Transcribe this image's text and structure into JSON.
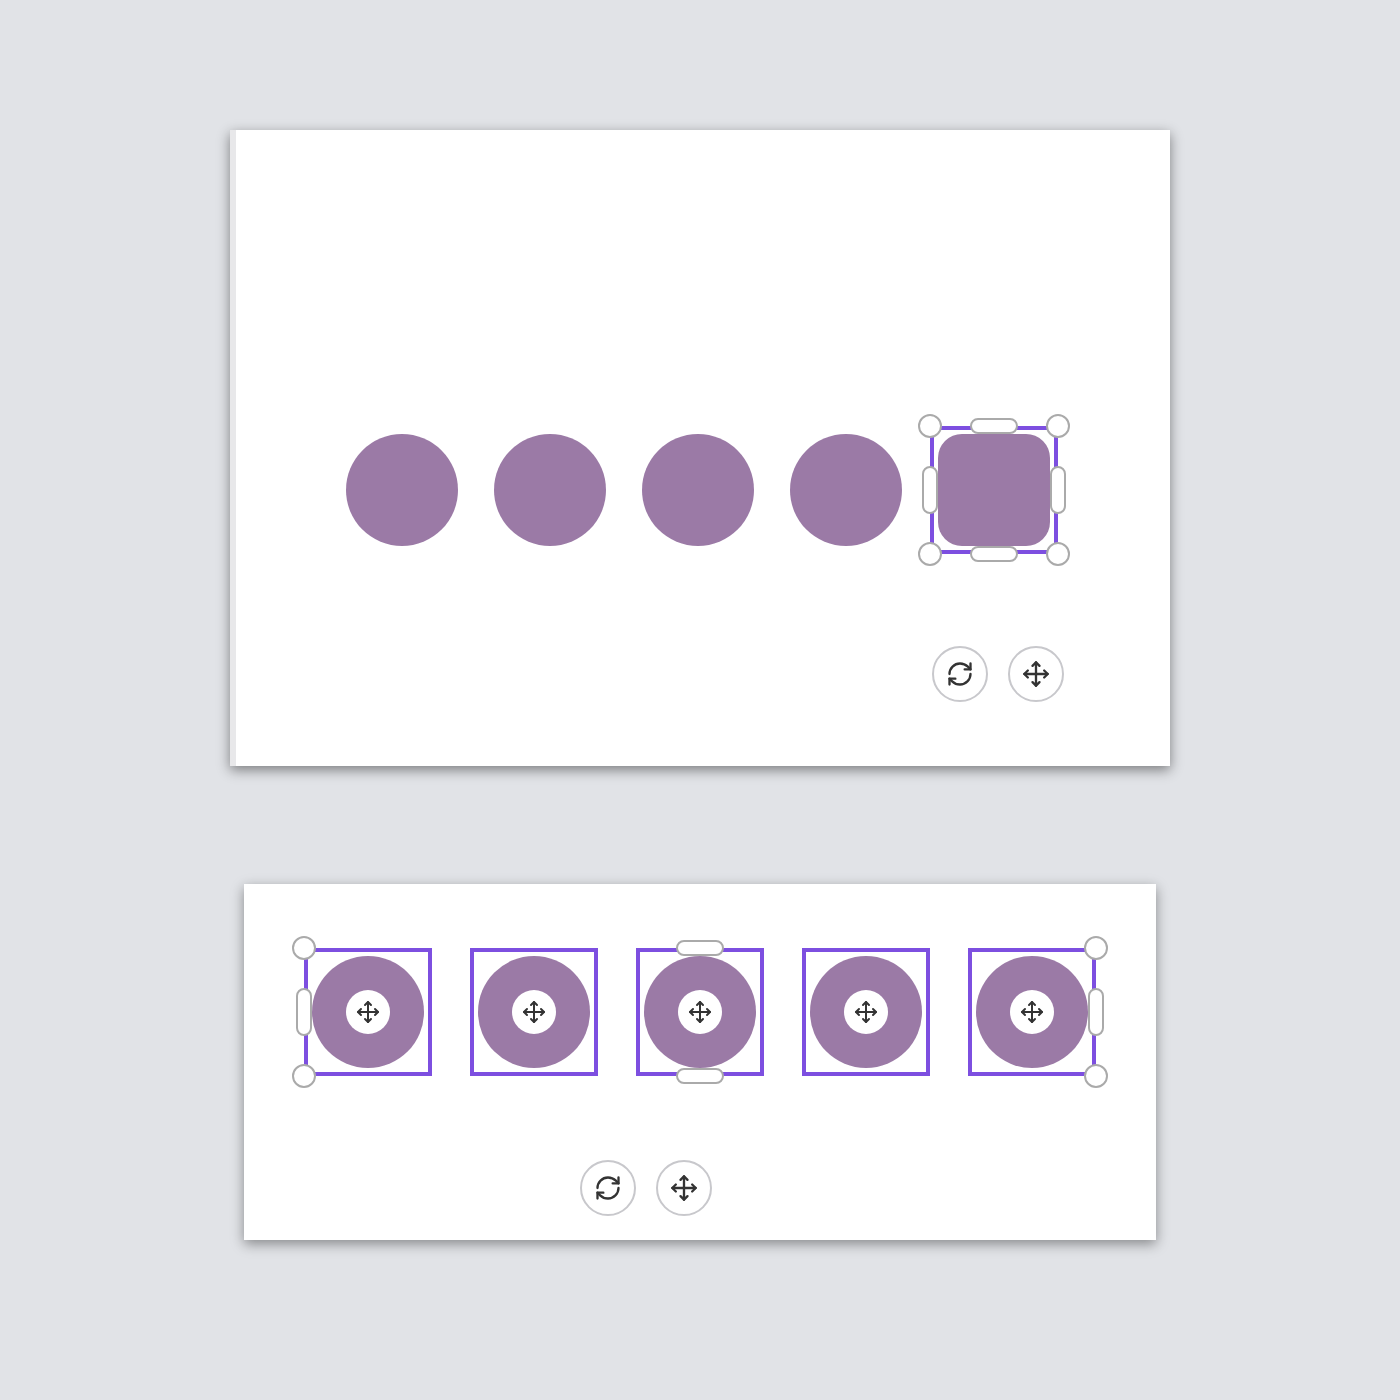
{
  "canvases": [
    {
      "shapes": [
        {
          "kind": "circle",
          "selected": false
        },
        {
          "kind": "circle",
          "selected": false
        },
        {
          "kind": "circle",
          "selected": false
        },
        {
          "kind": "circle",
          "selected": false
        },
        {
          "kind": "rounded-square",
          "selected": true
        }
      ]
    },
    {
      "shapes": [
        {
          "kind": "circle",
          "selected": true
        },
        {
          "kind": "circle",
          "selected": true
        },
        {
          "kind": "circle",
          "selected": true
        },
        {
          "kind": "circle",
          "selected": true
        },
        {
          "kind": "circle",
          "selected": true
        }
      ]
    }
  ]
}
